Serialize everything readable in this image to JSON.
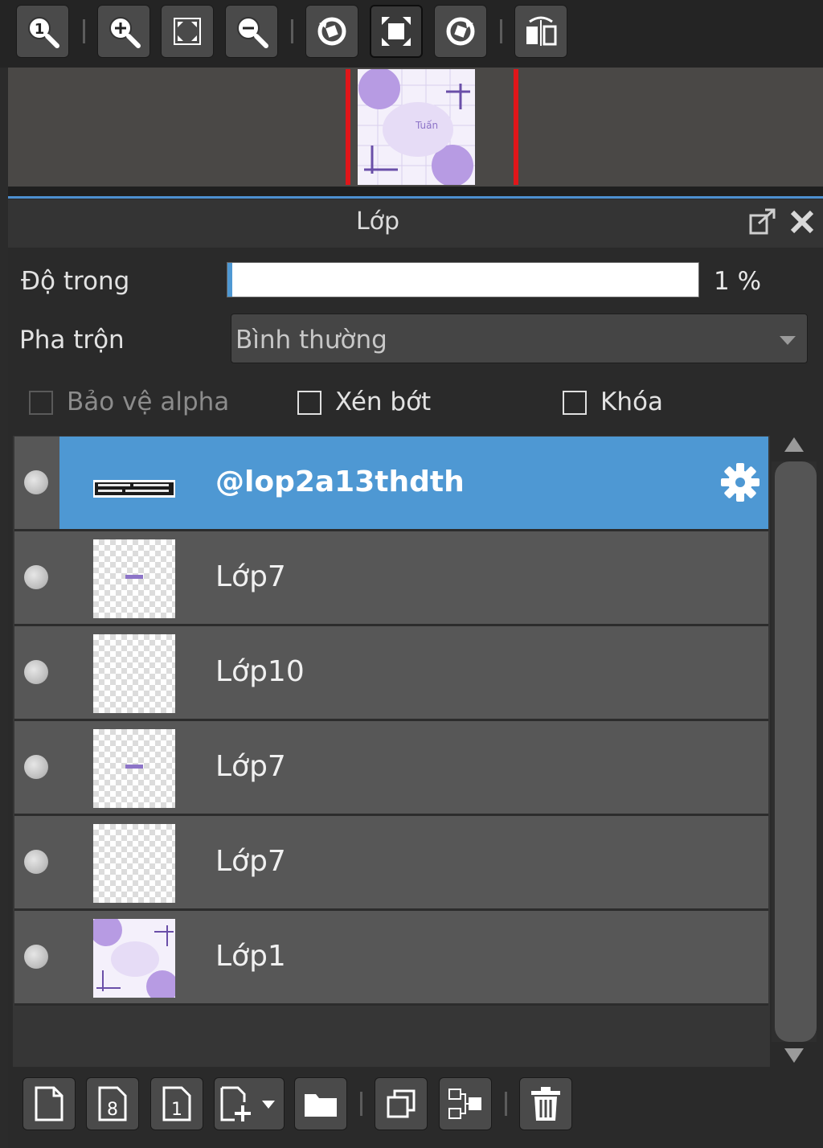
{
  "toolbar": {
    "buttons": [
      {
        "icon": "zoom-actual-size-icon"
      },
      {
        "icon": "zoom-in-icon"
      },
      {
        "icon": "fit-to-window-icon"
      },
      {
        "icon": "zoom-out-icon"
      },
      {
        "icon": "rotate-left-icon"
      },
      {
        "icon": "reset-view-icon",
        "active": true
      },
      {
        "icon": "rotate-right-icon"
      },
      {
        "icon": "flip-horizontal-icon"
      }
    ]
  },
  "navigator": {
    "thumbnail_text": "Tuấn"
  },
  "panel": {
    "title": "Lớp",
    "opacity_label": "Độ trong",
    "opacity_value": "1 %",
    "opacity_percent": 1,
    "blend_label": "Pha trộn",
    "blend_value": "Bình thường",
    "checkboxes": {
      "protect_alpha": {
        "label": "Bảo vệ alpha",
        "checked": false,
        "enabled": false
      },
      "clipping": {
        "label": "Xén bớt",
        "checked": false,
        "enabled": true
      },
      "lock": {
        "label": "Khóa",
        "checked": false,
        "enabled": true
      }
    }
  },
  "layers": [
    {
      "name": "@lop2a13thdth",
      "selected": true,
      "thumb": "text-banner"
    },
    {
      "name": "Lớp7",
      "selected": false,
      "thumb": "small-text"
    },
    {
      "name": "Lớp10",
      "selected": false,
      "thumb": "transparent"
    },
    {
      "name": "Lớp7",
      "selected": false,
      "thumb": "small-text"
    },
    {
      "name": "Lớp7",
      "selected": false,
      "thumb": "transparent"
    },
    {
      "name": "Lớp1",
      "selected": false,
      "thumb": "artwork"
    }
  ],
  "bottom_toolbar": {
    "buttons": [
      {
        "icon": "new-layer-icon"
      },
      {
        "icon": "new-8bit-layer-icon"
      },
      {
        "icon": "new-1bit-layer-icon"
      },
      {
        "icon": "add-layer-dropdown-icon"
      },
      {
        "icon": "new-folder-icon"
      },
      {
        "icon": "duplicate-layer-icon"
      },
      {
        "icon": "merge-down-icon"
      },
      {
        "icon": "delete-layer-icon"
      }
    ]
  },
  "colors": {
    "selected_row": "#4e98d3",
    "row": "#575757",
    "accent_line": "#4d8fd0",
    "navigator_frame": "#e0161a",
    "artwork_purple": "#9b7fd6"
  }
}
